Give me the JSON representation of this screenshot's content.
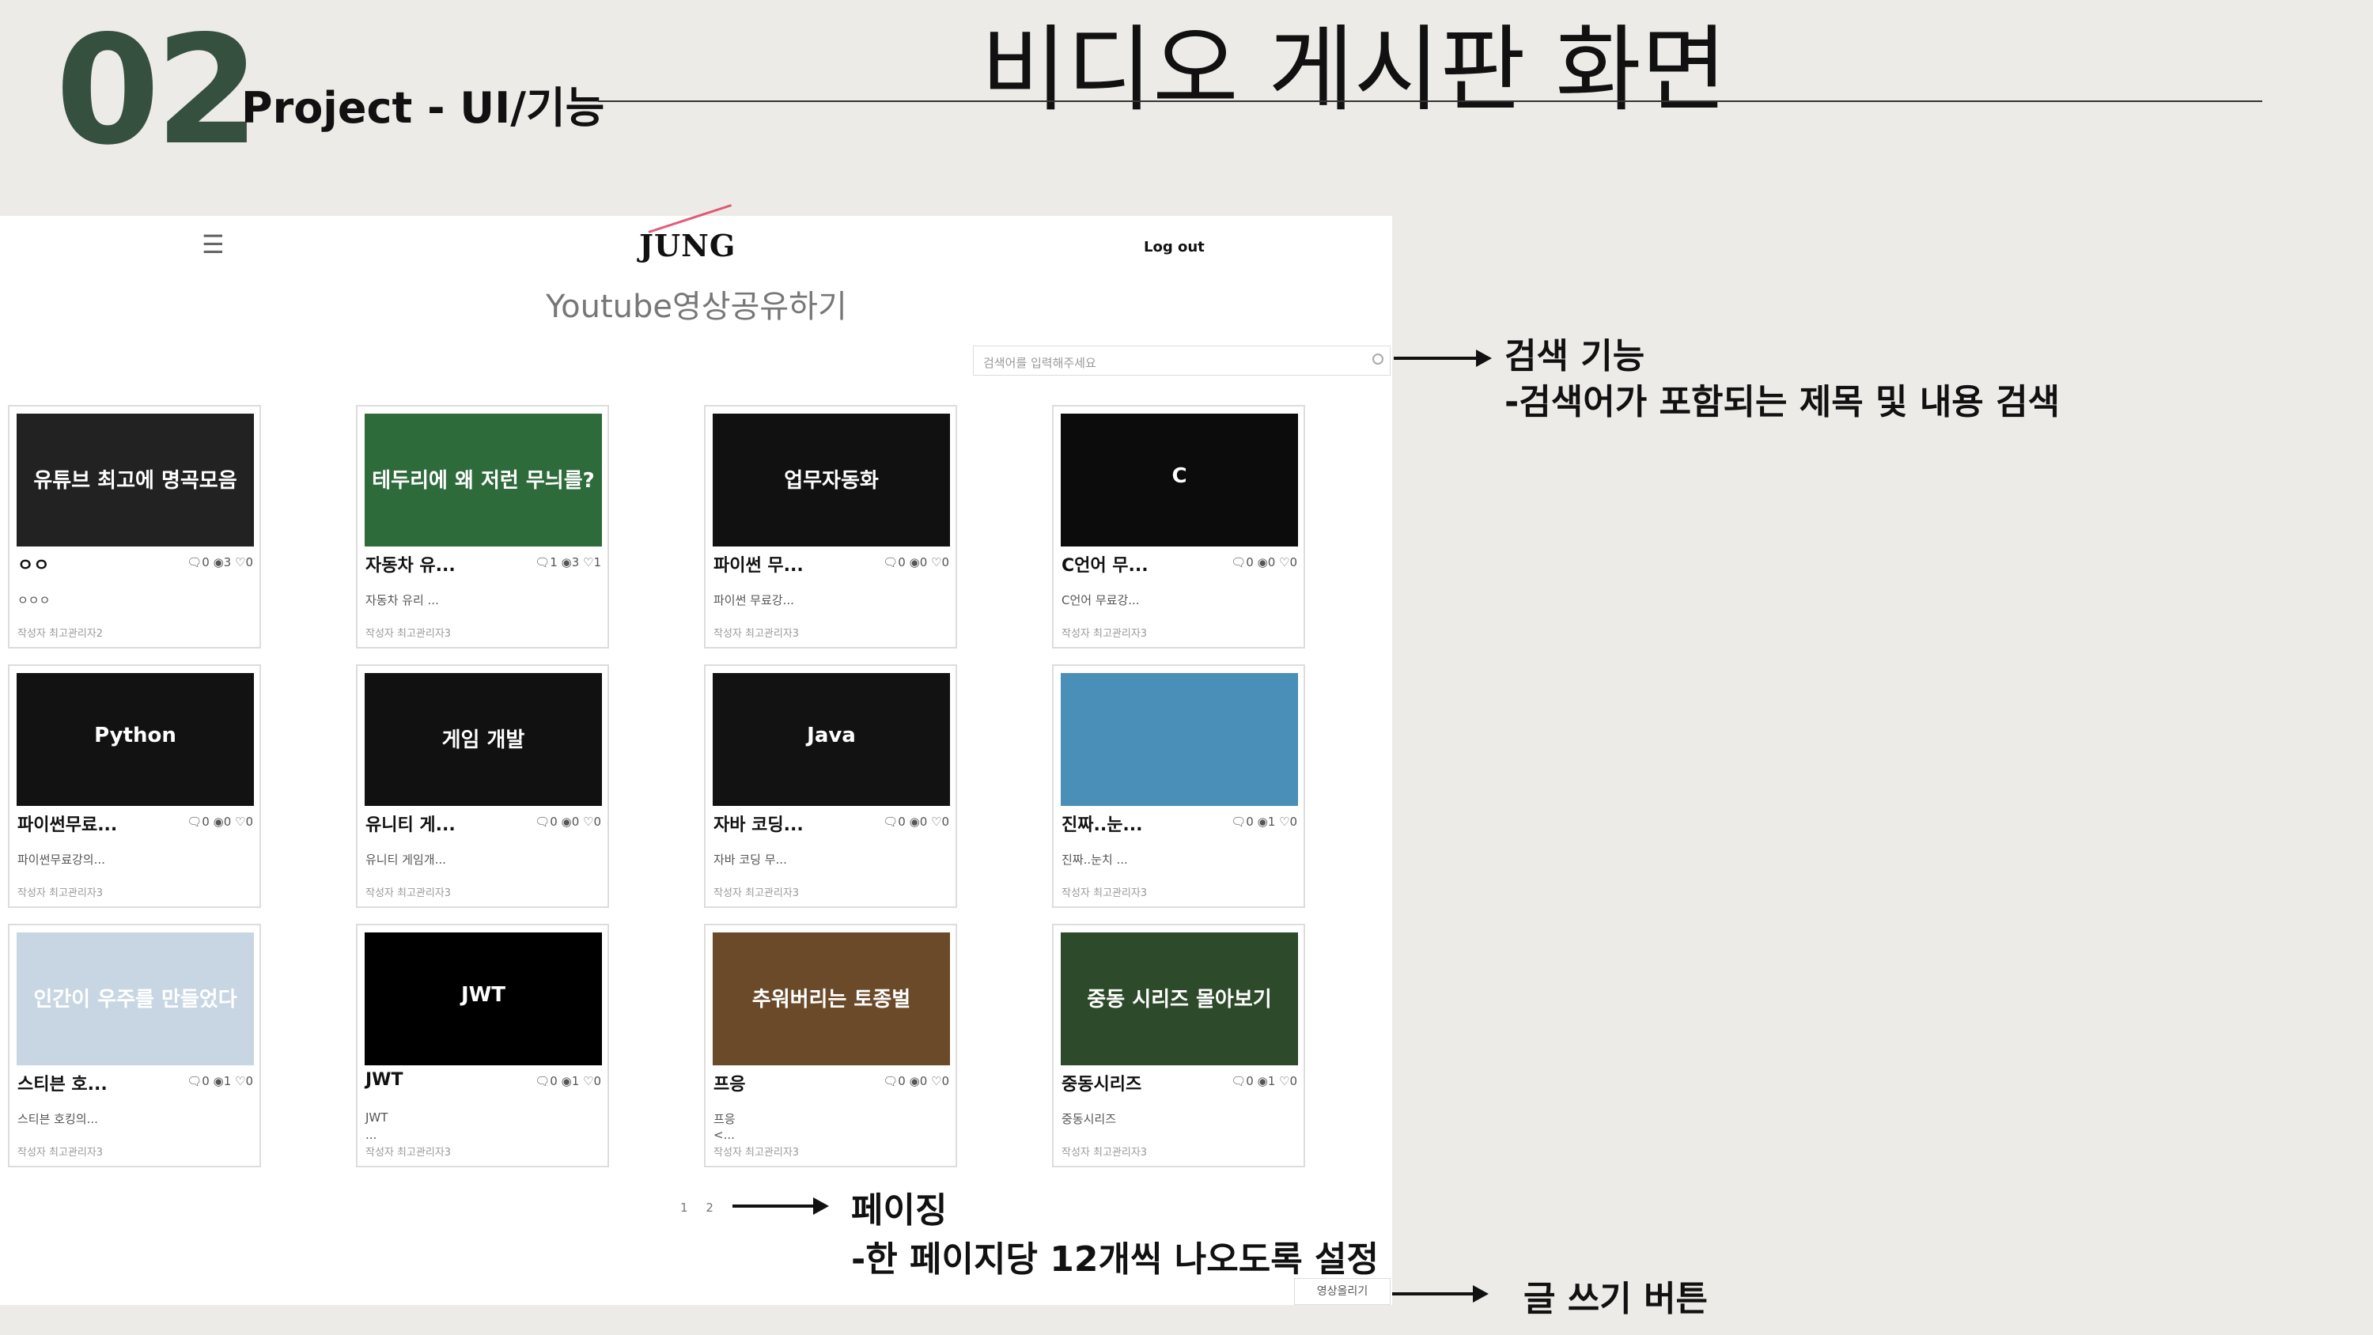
{
  "slide": {
    "number": "02",
    "section": "Project - UI/기능",
    "title": "비디오 게시판 화면"
  },
  "app": {
    "menu_icon": "hamburger-icon",
    "logo": "JUNG",
    "logout": "Log out",
    "page_title": "Youtube영상공유하기",
    "search_placeholder": "검색어를 입력해주세요",
    "write_button": "영상올리기",
    "pages": [
      "1",
      "2"
    ]
  },
  "cards": [
    {
      "title": "ㅇㅇ",
      "comments": "0",
      "views": "3",
      "likes": "0",
      "desc": "ㅇㅇㅇ",
      "author": "작성자 최고관리자2",
      "thumb_text": "유튜브 최고에 명곡모음",
      "thumb_bg": "#222"
    },
    {
      "title": "자동차 유...",
      "comments": "1",
      "views": "3",
      "likes": "1",
      "desc": "자동차 유리 ...",
      "author": "작성자 최고관리자3",
      "thumb_text": "테두리에 왜 저런 무늬를?",
      "thumb_bg": "#2e6b3a"
    },
    {
      "title": "파이썬 무...",
      "comments": "0",
      "views": "0",
      "likes": "0",
      "desc": "파이썬 무료강...",
      "author": "작성자 최고관리자3",
      "thumb_text": "업무자동화",
      "thumb_bg": "#111"
    },
    {
      "title": "C언어 무...",
      "comments": "0",
      "views": "0",
      "likes": "0",
      "desc": "C언어 무료강...",
      "author": "작성자 최고관리자3",
      "thumb_text": "C",
      "thumb_bg": "#0c0c0c"
    },
    {
      "title": "파이썬무료...",
      "comments": "0",
      "views": "0",
      "likes": "0",
      "desc": "파이썬무료강의...",
      "author": "작성자 최고관리자3",
      "thumb_text": "Python",
      "thumb_bg": "#121212"
    },
    {
      "title": "유니티 게...",
      "comments": "0",
      "views": "0",
      "likes": "0",
      "desc": "유니티 게임개...",
      "author": "작성자 최고관리자3",
      "thumb_text": "게임 개발",
      "thumb_bg": "#111"
    },
    {
      "title": "자바 코딩...",
      "comments": "0",
      "views": "0",
      "likes": "0",
      "desc": "자바 코딩 무...",
      "author": "작성자 최고관리자3",
      "thumb_text": "Java",
      "thumb_bg": "#121212"
    },
    {
      "title": "진짜..눈...",
      "comments": "0",
      "views": "1",
      "likes": "0",
      "desc": "진짜..눈치 ...",
      "author": "작성자 최고관리자3",
      "thumb_text": "",
      "thumb_bg": "#4a8fb8"
    },
    {
      "title": "스티븐 호...",
      "comments": "0",
      "views": "1",
      "likes": "0",
      "desc": "스티븐 호킹의...",
      "author": "작성자 최고관리자3",
      "thumb_text": "인간이 우주를 만들었다",
      "thumb_bg": "#c7d6e2"
    },
    {
      "title": "JWT",
      "comments": "0",
      "views": "1",
      "likes": "0",
      "desc": "JWT",
      "desc2": "...",
      "author": "작성자 최고관리자3",
      "thumb_text": "JWT",
      "thumb_bg": "#000"
    },
    {
      "title": "프응",
      "comments": "0",
      "views": "0",
      "likes": "0",
      "desc": "프응",
      "desc2": "<...",
      "author": "작성자 최고관리자3",
      "thumb_text": "추워버리는 토종벌",
      "thumb_bg": "#6b4a2a"
    },
    {
      "title": "중동시리즈",
      "comments": "0",
      "views": "1",
      "likes": "0",
      "desc": "중동시리즈",
      "author": "작성자 최고관리자3",
      "thumb_text": "중동 시리즈 몰아보기",
      "thumb_bg": "#2d4a2a"
    }
  ],
  "annotations": {
    "search_title": "검색 기능",
    "search_desc": "-검색어가 포함되는 제목 및 내용 검색",
    "paging_title": "페이징",
    "paging_desc": "-한 페이지당 12개씩 나오도록 설정",
    "write_title": "글 쓰기 버튼"
  }
}
